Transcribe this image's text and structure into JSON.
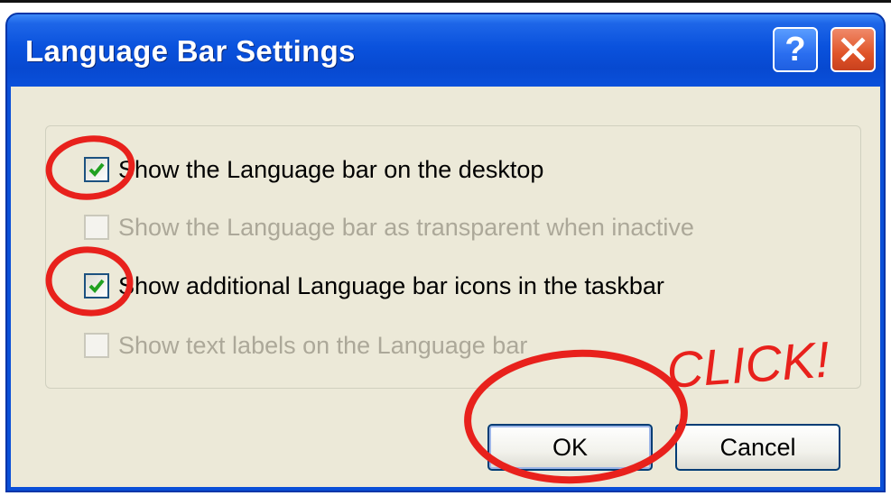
{
  "dialog": {
    "title": "Language Bar Settings",
    "help_icon": "question-mark-icon",
    "close_icon": "close-x-icon"
  },
  "options": [
    {
      "label": "Show the Language bar on the desktop",
      "checked": true,
      "enabled": true
    },
    {
      "label": "Show the Language bar as transparent when inactive",
      "checked": false,
      "enabled": false
    },
    {
      "label": "Show additional Language bar icons in the taskbar",
      "checked": true,
      "enabled": true
    },
    {
      "label": "Show text labels on the Language bar",
      "checked": false,
      "enabled": false
    }
  ],
  "buttons": {
    "ok_label": "OK",
    "cancel_label": "Cancel"
  },
  "annotation": {
    "text": "CLICK!",
    "color": "#e8211c"
  },
  "colors": {
    "titlebar": "#0a52dd",
    "client": "#ece9d8",
    "checkmark": "#21a121"
  }
}
